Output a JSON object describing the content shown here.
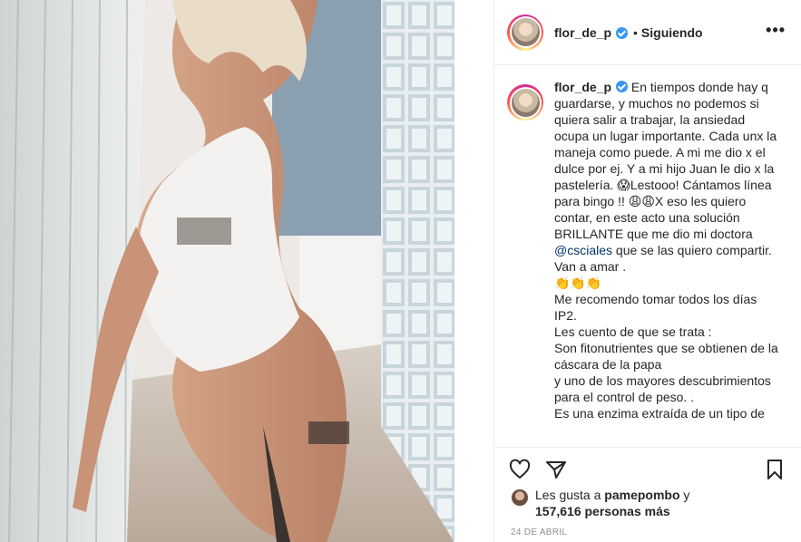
{
  "post": {
    "username": "flor_de_p",
    "follow_separator": "•",
    "follow_status": "Siguiendo"
  },
  "caption": {
    "username": "flor_de_p",
    "text_before_mention": "En tiempos donde hay q guardarse, y muchos no podemos si quiera salir a trabajar, la ansiedad ocupa un lugar importante. Cada unx la maneja como puede. A mi me dio x el dulce por ej. Y a mi hijo Juan le dio x la pastelería. 😱Lestooo! Cántamos línea para bingo !! 😩😩X eso les quiero contar, en este acto una solución BRILLANTE que me dio mi doctora ",
    "mention": "@csciales",
    "text_after_mention": " que se las quiero compartir. Van a amar .\n👏👏👏\nMe recomendo tomar todos los días IP2.\nLes cuento de que se trata :\nSon fitonutrientes que se obtienen de la cáscara de la papa\ny uno de los mayores descubrimientos para el control de peso. .\nEs una enzima extraída de un tipo de"
  },
  "likes": {
    "prefix": "Les gusta a ",
    "user": "pamepombo",
    "connector": " y",
    "count": "157,616 personas más"
  },
  "date": "24 DE ABRIL",
  "icons": {
    "more": "more-options-icon",
    "like": "heart-icon",
    "share": "paper-plane-icon",
    "save": "bookmark-icon",
    "verified": "verified-badge-icon"
  },
  "colors": {
    "verified": "#3897f0",
    "mention": "#003569",
    "date": "#8e8e8e",
    "border": "#efefef"
  }
}
